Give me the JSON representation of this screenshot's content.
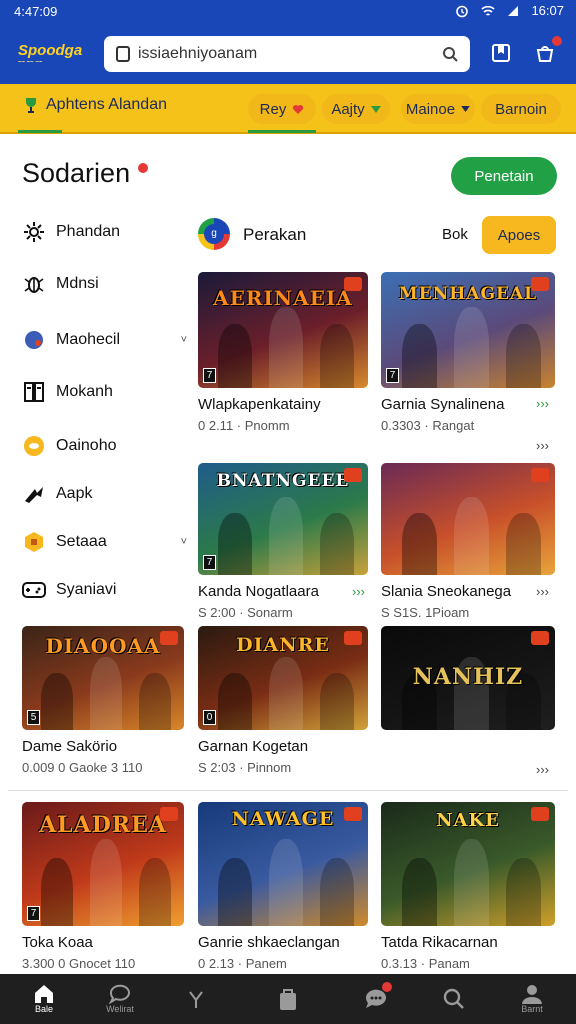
{
  "status": {
    "time": "4:47:09",
    "clock": "16:07"
  },
  "header": {
    "logo": "Spoodga",
    "logo_sub": "~~ ~~ ~~",
    "search_value": "issiaehniyoanam"
  },
  "categories": {
    "home_label": "Aphtens Alandan",
    "pills": [
      {
        "label": "Rey",
        "icon": "heart-icon"
      },
      {
        "label": "Aajty",
        "icon": "chevron-down-icon"
      },
      {
        "label": "Mainoe",
        "icon": "chevron-down-icon"
      },
      {
        "label": "Barnoin",
        "icon": ""
      }
    ]
  },
  "page": {
    "title": "Sodarien",
    "primary_button": "Penetain"
  },
  "sidebar": {
    "items": [
      {
        "label": "Phandan",
        "icon": "gear-icon"
      },
      {
        "label": "Mdnsi",
        "icon": "bug-icon"
      },
      {
        "label": "Maohecil",
        "icon": "blob-icon",
        "chevron": "˅"
      },
      {
        "label": "Mokanh",
        "icon": "book-icon"
      },
      {
        "label": "Oainoho",
        "icon": "coin-icon"
      },
      {
        "label": "Aapk",
        "icon": "arrow-icon"
      },
      {
        "label": "Setaaa",
        "icon": "badge-icon",
        "chevron": "˅"
      },
      {
        "label": "Syaniavi",
        "icon": "gamepad-icon"
      }
    ]
  },
  "section": {
    "title": "Perakan",
    "link": "Bok",
    "button": "Apoes",
    "icon_label": "g"
  },
  "more_chevron": "›››",
  "games": [
    {
      "art": "AERINAEIA",
      "name": "Wlapkapenkatainy",
      "meta": "0 2.11 · Pnomm",
      "age": "7",
      "colors": [
        "#1b1a3a",
        "#6b1f2a",
        "#d88a2c"
      ],
      "art_color": "#ff8a1c"
    },
    {
      "art": "MENHAGEAL",
      "name": "Garnia Synalinena",
      "meta": "0.3303 · Rangat",
      "age": "7",
      "colors": [
        "#3b6fb4",
        "#5b4a7a",
        "#c9832e"
      ],
      "art_color": "#ffb52a"
    },
    {
      "art": "BNATNGEEE",
      "name": "Kanda Nogatlaara",
      "meta": "S 2:00 · Sonarm",
      "age": "7",
      "colors": [
        "#1f5c8a",
        "#2c7a4a",
        "#c9a13a"
      ],
      "art_color": "#ffffff"
    },
    {
      "art": "",
      "name": "Slania Sneokanega",
      "meta": "S S1S. 1Pioam",
      "age": "",
      "colors": [
        "#6a2a55",
        "#c8502a",
        "#e8a43a"
      ],
      "art_color": "#ffffff"
    },
    {
      "art": "DIAOOAA",
      "name": "Dame Sakörio",
      "meta": "0.009 0 Gaoke 3 110",
      "age": "5",
      "colors": [
        "#3a2418",
        "#8a3a1c",
        "#d9872a"
      ],
      "art_color": "#ff9a24"
    },
    {
      "art": "DIANRE",
      "name": "Garnan Kogetan",
      "meta": "S 2:03 · Pinnom",
      "age": "0",
      "colors": [
        "#2a1a10",
        "#7a2d14",
        "#d2a23a"
      ],
      "art_color": "#ffb52a"
    },
    {
      "art": "NANHIZ",
      "name": "",
      "meta": "",
      "age": "",
      "colors": [
        "#0a0a0a",
        "#141414",
        "#1f1f1f"
      ],
      "art_color": "#e6c35a"
    },
    {
      "art": "ALADREA",
      "name": "Toka Koaa",
      "meta": "3.300 0 Gnocet 110",
      "age": "7",
      "colors": [
        "#6a1a1a",
        "#c03a1a",
        "#f0a030"
      ],
      "art_color": "#ff9a24"
    },
    {
      "art": "NAWAGE",
      "name": "Ganrie shkaeclangan",
      "meta": "0 2.13 · Panem",
      "age": "",
      "colors": [
        "#153a7a",
        "#3a5aa0",
        "#d08a2a"
      ],
      "art_color": "#ffc02a"
    },
    {
      "art": "NAKE",
      "name": "Tatda Rikacarnan",
      "meta": "0.3.13 · Panam",
      "age": "",
      "colors": [
        "#1a2a1a",
        "#3a5a2a",
        "#d0a02a"
      ],
      "art_color": "#ffd24a"
    }
  ],
  "bottom_nav": [
    {
      "label": "Bale",
      "icon": "home-icon",
      "active": true
    },
    {
      "label": "Welirat",
      "icon": "chat-icon"
    },
    {
      "label": "",
      "icon": "heart-icon"
    },
    {
      "label": "",
      "icon": "bag-icon"
    },
    {
      "label": "",
      "icon": "message-icon",
      "badge": true
    },
    {
      "label": "",
      "icon": "search-icon"
    },
    {
      "label": "Barnt",
      "icon": "profile-icon"
    }
  ],
  "colors": {
    "brand_blue": "#1a47b8",
    "brand_yellow": "#f5c21a",
    "accent_green": "#22a045",
    "badge_red": "#e53935"
  }
}
